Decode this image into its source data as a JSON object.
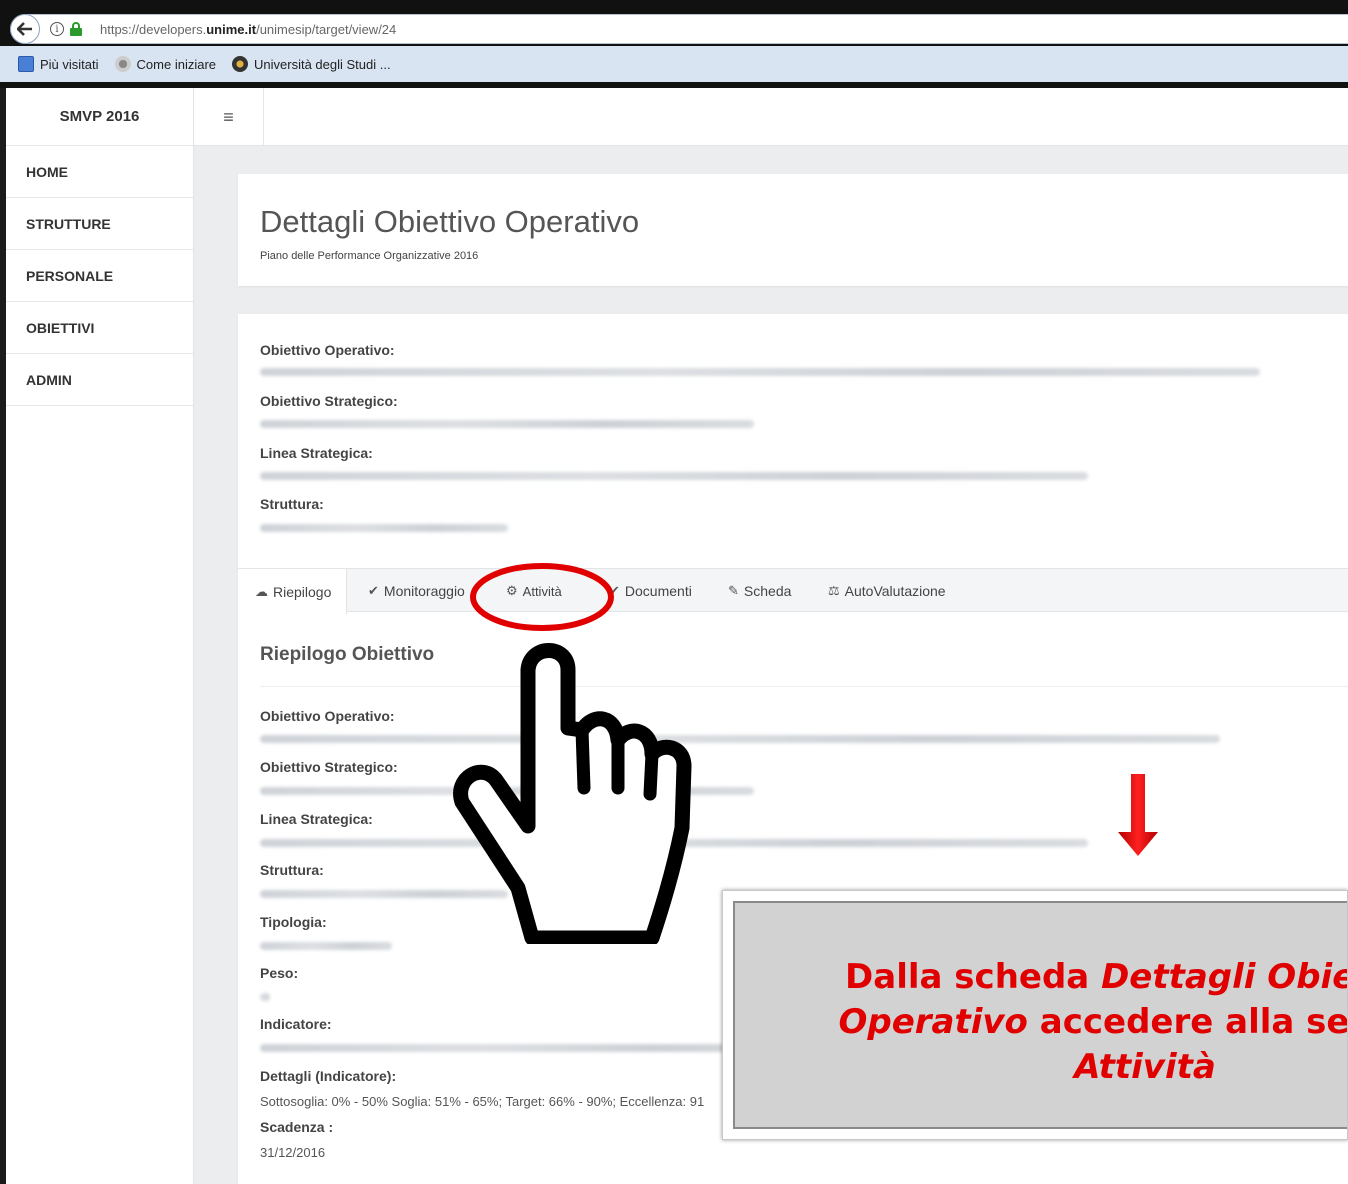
{
  "browser": {
    "url_prefix": "https://developers.",
    "url_domain": "unime.it",
    "url_path": "/unimesip/target/view/24",
    "bookmarks": [
      "Più visitati",
      "Come iniziare",
      "Università degli Studi ..."
    ]
  },
  "app": {
    "brand": "SMVP 2016",
    "menu_icon": "≡",
    "nav": [
      "HOME",
      "STRUTTURE",
      "PERSONALE",
      "OBIETTIVI",
      "ADMIN"
    ]
  },
  "header": {
    "title": "Dettagli Obiettivo Operativo",
    "subtitle": "Piano delle Performance Organizzative 2016"
  },
  "details": {
    "obiettivo_operativo": "Obiettivo Operativo:",
    "obiettivo_strategico": "Obiettivo Strategico:",
    "linea_strategica": "Linea Strategica:",
    "struttura": "Struttura:"
  },
  "tabs": [
    {
      "label": "Riepilogo",
      "icon": "cloud-icon",
      "glyph": "☁"
    },
    {
      "label": "Monitoraggio",
      "icon": "check-icon",
      "glyph": "✔"
    },
    {
      "label": "Attività",
      "icon": "gears-icon",
      "glyph": "⚙"
    },
    {
      "label": "Documenti",
      "icon": "check-icon",
      "glyph": "✔"
    },
    {
      "label": "Scheda",
      "icon": "edit-icon",
      "glyph": "✎"
    },
    {
      "label": "AutoValutazione",
      "icon": "balance-scale-icon",
      "glyph": "⚖"
    }
  ],
  "summary": {
    "title": "Riepilogo Obiettivo",
    "labels": {
      "operativo": "Obiettivo Operativo:",
      "strategico": "Obiettivo Strategico:",
      "linea": "Linea Strategica:",
      "struttura": "Struttura:",
      "tipologia": "Tipologia:",
      "peso": "Peso:",
      "indicatore": "Indicatore:",
      "dettagli": "Dettagli (Indicatore):",
      "scadenza": "Scadenza :"
    },
    "dettagli_value": "Sottosoglia: 0% - 50% Soglia: 51% - 65%; Target: 66% - 90%; Eccellenza: 91",
    "scadenza_value": "31/12/2016"
  },
  "callout": {
    "line1_plain": "Dalla scheda ",
    "line1_italic": "Dettagli Obiettivo",
    "line2_italic": "Operativo",
    "line2_plain": " accedere alla sezione",
    "line3_italic": "Attività"
  },
  "colors": {
    "annotation_red": "#e00000",
    "success_green": "#2a9a2a"
  }
}
